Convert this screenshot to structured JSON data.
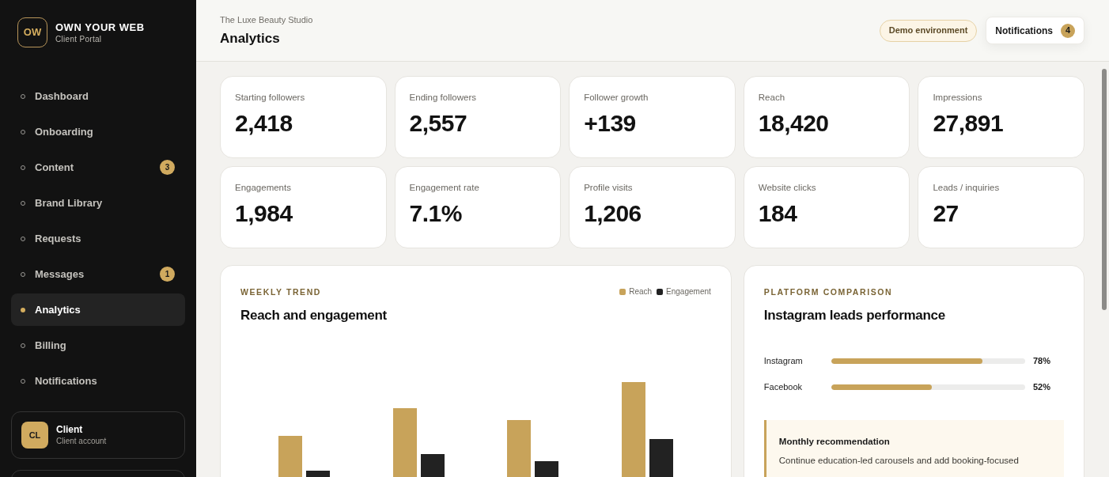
{
  "sidebar": {
    "brand": {
      "logo": "OW",
      "name": "OWN YOUR WEB",
      "tagline": "Client Portal"
    },
    "items": [
      {
        "label": "Dashboard",
        "selected": false
      },
      {
        "label": "Onboarding",
        "selected": false
      },
      {
        "label": "Content",
        "badge": "3",
        "selected": false
      },
      {
        "label": "Brand Library",
        "selected": false
      },
      {
        "label": "Requests",
        "selected": false
      },
      {
        "label": "Messages",
        "badge": "1",
        "selected": false
      },
      {
        "label": "Analytics",
        "selected": true
      },
      {
        "label": "Billing",
        "selected": false
      },
      {
        "label": "Notifications",
        "selected": false
      }
    ],
    "account": {
      "avatar": "CL",
      "name": "Client",
      "role": "Client account"
    }
  },
  "header": {
    "subtitle": "The Luxe Beauty Studio",
    "title": "Analytics",
    "env_badge": "Demo environment",
    "notifications": {
      "label": "Notifications",
      "count": "4"
    }
  },
  "metrics": [
    {
      "label": "Starting followers",
      "value": "2,418"
    },
    {
      "label": "Ending followers",
      "value": "2,557"
    },
    {
      "label": "Follower growth",
      "value": "+139"
    },
    {
      "label": "Reach",
      "value": "18,420"
    },
    {
      "label": "Impressions",
      "value": "27,891"
    },
    {
      "label": "Engagements",
      "value": "1,984"
    },
    {
      "label": "Engagement rate",
      "value": "7.1%"
    },
    {
      "label": "Profile visits",
      "value": "1,206"
    },
    {
      "label": "Website clicks",
      "value": "184"
    },
    {
      "label": "Leads / inquiries",
      "value": "27"
    }
  ],
  "trend_card": {
    "eyebrow": "WEEKLY TREND",
    "title": "Reach and engagement",
    "legend": [
      {
        "label": "Reach",
        "color": "#c8a35a"
      },
      {
        "label": "Engagement",
        "color": "#222222"
      }
    ]
  },
  "platform_card": {
    "eyebrow": "PLATFORM COMPARISON",
    "title": "Instagram leads performance",
    "platforms": [
      {
        "name": "Instagram",
        "level": 0.78,
        "reading": "78%"
      },
      {
        "name": "Facebook",
        "level": 0.52,
        "reading": "52%"
      }
    ],
    "recommendation": {
      "title": "Monthly recommendation",
      "text": "Continue education-led carousels and add booking-focused"
    }
  }
}
